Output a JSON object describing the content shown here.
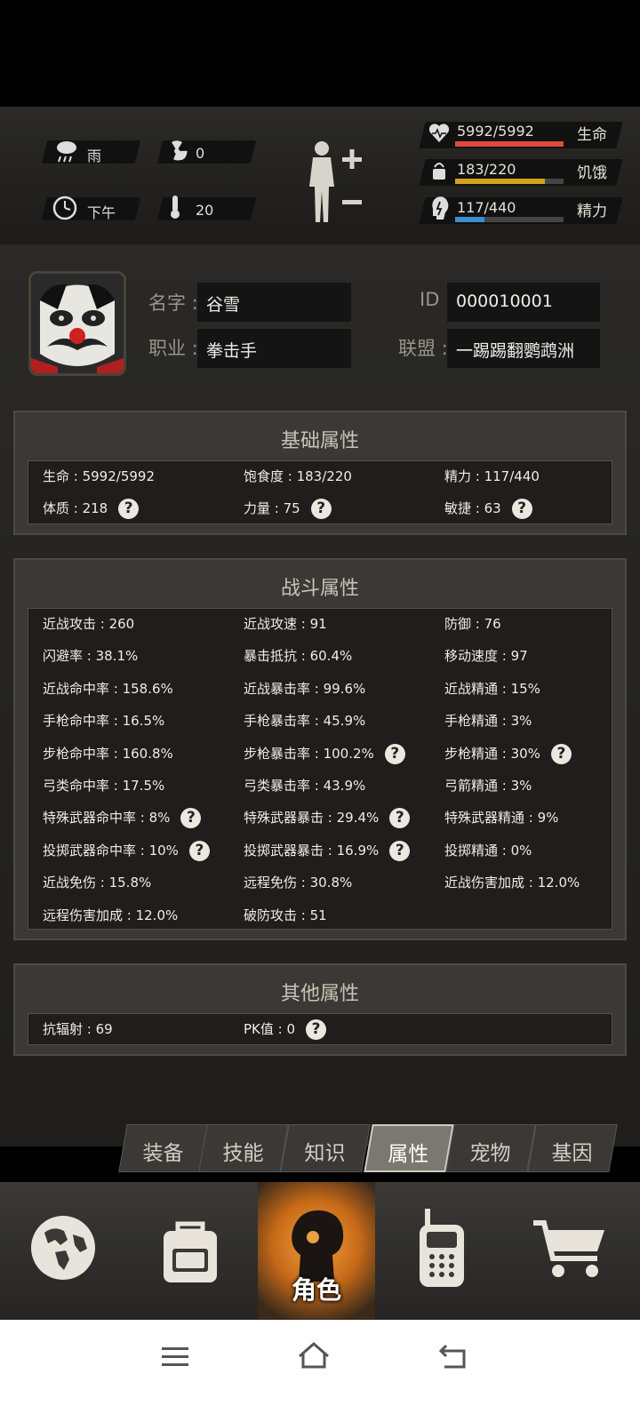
{
  "status": {
    "weather": "雨",
    "radiation": "0",
    "time": "下午",
    "temperature": "20",
    "health": {
      "text": "5992/5992",
      "label": "生命",
      "fraction": 1.0,
      "color": "#e04a3a"
    },
    "hunger": {
      "text": "183/220",
      "label": "饥饿",
      "fraction": 0.83,
      "color": "#d4a020"
    },
    "energy": {
      "text": "117/440",
      "label": "精力",
      "fraction": 0.27,
      "color": "#3a8fd0"
    }
  },
  "profile": {
    "name_label": "名字",
    "name_value": "谷雪",
    "job_label": "职业",
    "job_value": "拳击手",
    "id_label": "ID",
    "id_value": "000010001",
    "alliance_label": "联盟",
    "alliance_value": "一踢踢翻鹦鹉洲"
  },
  "basic": {
    "title": "基础属性",
    "rows": [
      [
        "生命 : 5992/5992",
        "饱食度 : 183/220",
        "精力 : 117/440"
      ],
      [
        "体质 : 218",
        "力量 : 75",
        "敏捷 : 63"
      ]
    ]
  },
  "combat": {
    "title": "战斗属性",
    "rows": [
      [
        "近战攻击 : 260",
        "近战攻速 : 91",
        "防御 : 76"
      ],
      [
        "闪避率 : 38.1%",
        "暴击抵抗 : 60.4%",
        "移动速度 : 97"
      ],
      [
        "近战命中率 : 158.6%",
        "近战暴击率 : 99.6%",
        "近战精通 : 15%"
      ],
      [
        "手枪命中率 : 16.5%",
        "手枪暴击率 : 45.9%",
        "手枪精通 : 3%"
      ],
      [
        "步枪命中率 : 160.8%",
        "步枪暴击率 : 100.2%",
        "步枪精通 : 30%"
      ],
      [
        "弓类命中率 : 17.5%",
        "弓类暴击率 : 43.9%",
        "弓箭精通 : 3%"
      ],
      [
        "特殊武器命中率 : 8%",
        "特殊武器暴击 : 29.4%",
        "特殊武器精通 : 9%"
      ],
      [
        "投掷武器命中率 : 10%",
        "投掷武器暴击 : 16.9%",
        "投掷精通 : 0%"
      ],
      [
        "近战免伤 : 15.8%",
        "远程免伤 : 30.8%",
        "近战伤害加成 : 12.0%"
      ],
      [
        "远程伤害加成 : 12.0%",
        "破防攻击 : 51",
        ""
      ]
    ]
  },
  "other": {
    "title": "其他属性",
    "rows": [
      [
        "抗辐射 : 69",
        "PK值 : 0",
        ""
      ]
    ]
  },
  "tabs": [
    "装备",
    "技能",
    "知识",
    "属性",
    "宠物",
    "基因"
  ],
  "nav": {
    "active_label": "角色"
  }
}
